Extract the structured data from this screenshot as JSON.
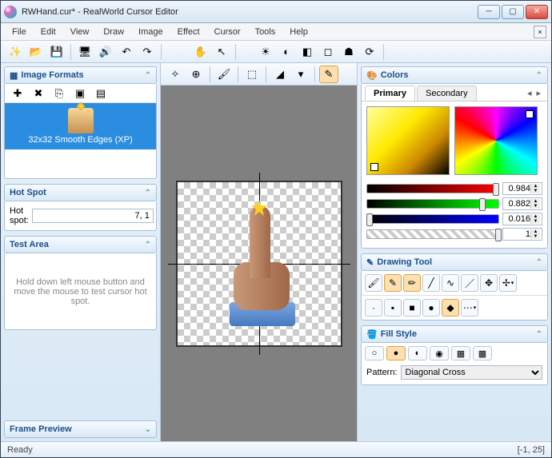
{
  "window": {
    "title": "RWHand.cur* - RealWorld Cursor Editor"
  },
  "menu": {
    "items": [
      "File",
      "Edit",
      "View",
      "Draw",
      "Image",
      "Effect",
      "Cursor",
      "Tools",
      "Help"
    ]
  },
  "panels": {
    "image_formats": {
      "title": "Image Formats",
      "selected": "32x32 Smooth Edges (XP)"
    },
    "hot_spot": {
      "title": "Hot Spot",
      "label": "Hot spot:",
      "value": "7, 1"
    },
    "test_area": {
      "title": "Test Area",
      "hint": "Hold down left mouse button and move the mouse to test cursor hot spot."
    },
    "frame_preview": {
      "title": "Frame Preview"
    },
    "colors": {
      "title": "Colors",
      "tabs": [
        "Primary",
        "Secondary"
      ],
      "active_tab": "Primary",
      "sliders": [
        {
          "value": "0.984",
          "pct": 98
        },
        {
          "value": "0.882",
          "pct": 88
        },
        {
          "value": "0.016",
          "pct": 2
        },
        {
          "value": "1",
          "pct": 100
        }
      ]
    },
    "drawing_tool": {
      "title": "Drawing Tool"
    },
    "fill_style": {
      "title": "Fill Style",
      "pattern_label": "Pattern:",
      "pattern_value": "Diagonal Cross"
    }
  },
  "status": {
    "text": "Ready",
    "coords": "[-1, 25]"
  }
}
